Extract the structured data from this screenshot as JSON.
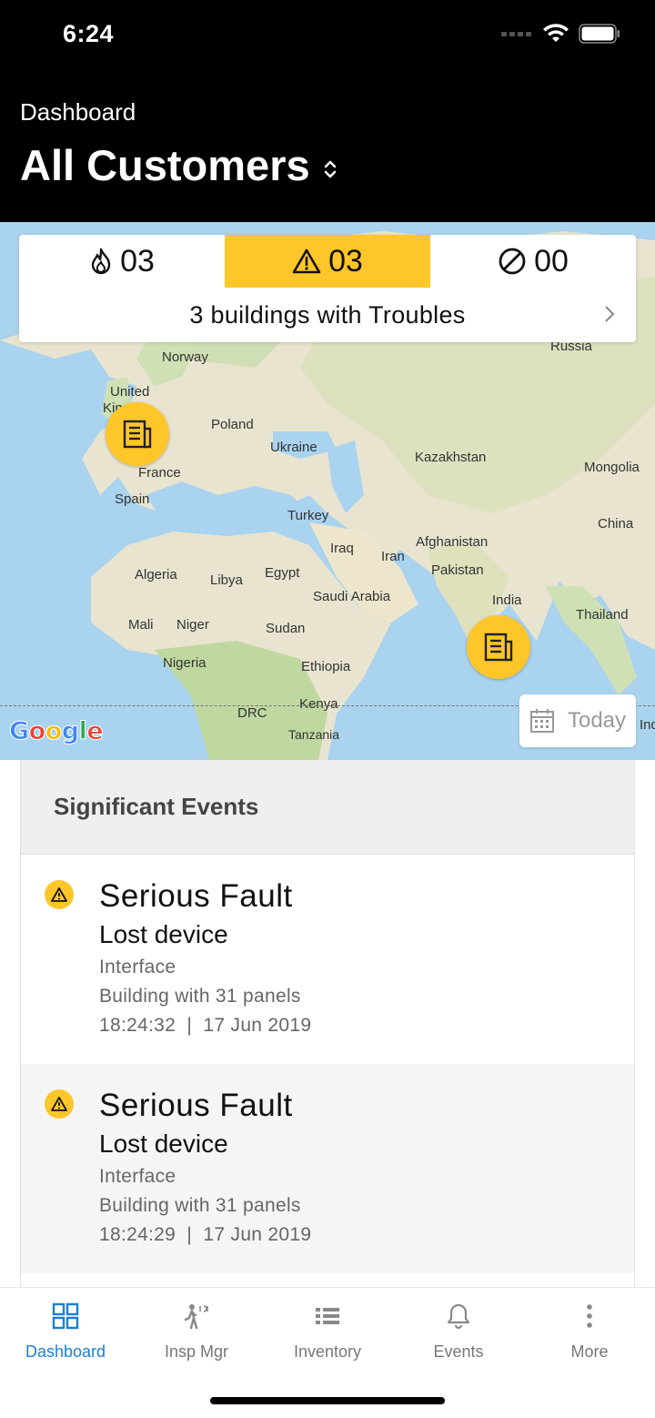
{
  "status_bar": {
    "time": "6:24"
  },
  "header": {
    "subtitle": "Dashboard",
    "title": "All Customers"
  },
  "summary": {
    "fire_count": "03",
    "trouble_count": "03",
    "disabled_count": "00",
    "text": "3 buildings with Troubles"
  },
  "map": {
    "labels": {
      "russia": "Russia",
      "norway": "Norway",
      "uk1": "United",
      "uk2": "Kin",
      "poland": "Poland",
      "ukraine": "Ukraine",
      "kazakhstan": "Kazakhstan",
      "mongolia": "Mongolia",
      "france": "France",
      "spain": "Spain",
      "turkey": "Turkey",
      "china": "China",
      "iraq": "Iraq",
      "iran": "Iran",
      "afghanistan": "Afghanistan",
      "pakistan": "Pakistan",
      "algeria": "Algeria",
      "libya": "Libya",
      "egypt": "Egypt",
      "saudi": "Saudi Arabia",
      "india": "India",
      "thailand": "Thailand",
      "mali": "Mali",
      "niger": "Niger",
      "sudan": "Sudan",
      "nigeria": "Nigeria",
      "ethiopia": "Ethiopia",
      "kenya": "Kenya",
      "drc": "DRC",
      "tanzania": "Tanzania",
      "indo": "Ind"
    },
    "google": "Google",
    "today_label": "Today"
  },
  "events": {
    "header": "Significant Events",
    "items": [
      {
        "title": "Serious Fault",
        "subtitle": "Lost device",
        "type": "Interface",
        "building": "Building with 31 panels",
        "timestamp": "18:24:32  |  17 Jun 2019"
      },
      {
        "title": "Serious Fault",
        "subtitle": "Lost device",
        "type": "Interface",
        "building": "Building with 31 panels",
        "timestamp": "18:24:29  |  17 Jun 2019"
      }
    ]
  },
  "tabs": [
    {
      "label": "Dashboard",
      "icon": "grid-icon"
    },
    {
      "label": "Insp Mgr",
      "icon": "walking-person-icon"
    },
    {
      "label": "Inventory",
      "icon": "list-icon"
    },
    {
      "label": "Events",
      "icon": "bell-icon"
    },
    {
      "label": "More",
      "icon": "more-vertical-icon"
    }
  ],
  "colors": {
    "accent": "#ffc629",
    "tab_active": "#1a7fd6",
    "header_bg": "#000000"
  }
}
